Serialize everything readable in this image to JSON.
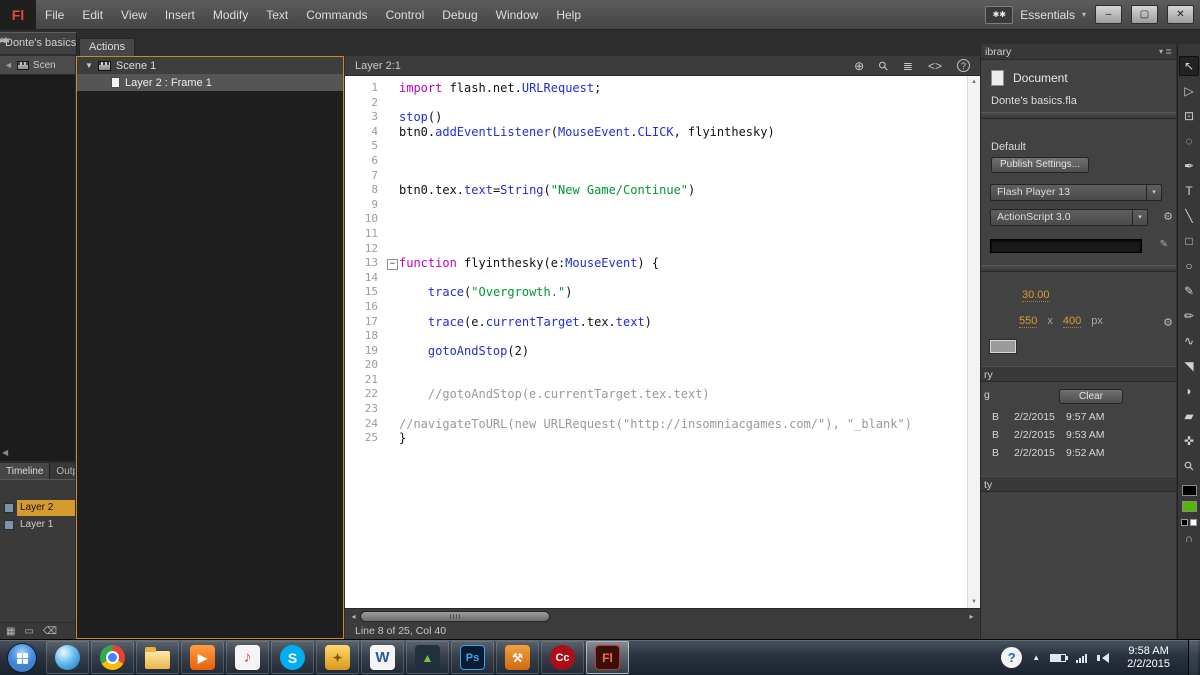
{
  "menu": {
    "logo": "Fl",
    "items": [
      "File",
      "Edit",
      "View",
      "Insert",
      "Modify",
      "Text",
      "Commands",
      "Control",
      "Debug",
      "Window",
      "Help"
    ],
    "workspace": "Essentials"
  },
  "window": {
    "workspace_badge": "✱✱"
  },
  "icons": {
    "caret": "▾",
    "min": "–",
    "max": "▢",
    "close": "✕",
    "collapse_pair": "◂◂",
    "expand_pair": "▸▸",
    "panel_menu": "▾ ≣",
    "back": "◄",
    "left_nudge": "◀",
    "tree_disclosure": "▼",
    "scroll_left": "◂",
    "scroll_right": "▸",
    "scroll_up": "▲",
    "scroll_down": "▼",
    "wrench": "⚙",
    "pencil": "✎",
    "tray_up": "▲"
  },
  "doc_tab": "Donte's basics",
  "edit_bar": {
    "scene": "Scen"
  },
  "actions": {
    "tab": "Actions",
    "scene": "Scene 1",
    "frame": "Layer 2 : Frame 1"
  },
  "editor": {
    "title": "Layer 2:1",
    "status": "Line 8 of 25, Col 40",
    "toolbar": [
      {
        "name": "insert-target-path",
        "glyph": "⊕"
      },
      {
        "name": "find",
        "glyph": "⚲"
      },
      {
        "name": "format-code",
        "glyph": "≣"
      },
      {
        "name": "code-snippets",
        "glyph": "<>"
      },
      {
        "name": "help",
        "glyph": "?"
      }
    ],
    "lines": [
      {
        "n": 1,
        "t": [
          [
            "k",
            "import"
          ],
          [
            "p",
            " flash.net."
          ],
          [
            "i",
            "URLRequest"
          ],
          [
            "p",
            ";"
          ]
        ]
      },
      {
        "n": 2,
        "t": []
      },
      {
        "n": 3,
        "t": [
          [
            "i",
            "stop"
          ],
          [
            "p",
            "()"
          ]
        ]
      },
      {
        "n": 4,
        "t": [
          [
            "p",
            "btn0."
          ],
          [
            "i",
            "addEventListener"
          ],
          [
            "p",
            "("
          ],
          [
            "i",
            "MouseEvent"
          ],
          [
            "p",
            "."
          ],
          [
            "i",
            "CLICK"
          ],
          [
            "p",
            ", flyinthesky)"
          ]
        ]
      },
      {
        "n": 5,
        "t": []
      },
      {
        "n": 6,
        "t": []
      },
      {
        "n": 7,
        "t": []
      },
      {
        "n": 8,
        "t": [
          [
            "p",
            "btn0.tex."
          ],
          [
            "i",
            "text"
          ],
          [
            "p",
            "="
          ],
          [
            "i",
            "String"
          ],
          [
            "p",
            "("
          ],
          [
            "s",
            "\"New Game/Continue\""
          ],
          [
            "p",
            ")"
          ]
        ]
      },
      {
        "n": 9,
        "t": []
      },
      {
        "n": 10,
        "t": []
      },
      {
        "n": 11,
        "t": []
      },
      {
        "n": 12,
        "t": []
      },
      {
        "n": 13,
        "fold": true,
        "t": [
          [
            "k",
            "function"
          ],
          [
            "p",
            " flyinthesky(e:"
          ],
          [
            "i",
            "MouseEvent"
          ],
          [
            "p",
            ") {"
          ]
        ]
      },
      {
        "n": 14,
        "t": []
      },
      {
        "n": 15,
        "t": [
          [
            "p",
            "    "
          ],
          [
            "i",
            "trace"
          ],
          [
            "p",
            "("
          ],
          [
            "s",
            "\"Overgrowth.\""
          ],
          [
            "p",
            ")"
          ]
        ]
      },
      {
        "n": 16,
        "t": []
      },
      {
        "n": 17,
        "t": [
          [
            "p",
            "    "
          ],
          [
            "i",
            "trace"
          ],
          [
            "p",
            "(e."
          ],
          [
            "i",
            "currentTarget"
          ],
          [
            "p",
            ".tex."
          ],
          [
            "i",
            "text"
          ],
          [
            "p",
            ")"
          ]
        ]
      },
      {
        "n": 18,
        "t": []
      },
      {
        "n": 19,
        "t": [
          [
            "p",
            "    "
          ],
          [
            "i",
            "gotoAndStop"
          ],
          [
            "p",
            "(2)"
          ]
        ]
      },
      {
        "n": 20,
        "t": []
      },
      {
        "n": 21,
        "t": []
      },
      {
        "n": 22,
        "t": [
          [
            "c",
            "    //gotoAndStop(e.currentTarget.tex.text)"
          ]
        ]
      },
      {
        "n": 23,
        "t": []
      },
      {
        "n": 24,
        "t": [
          [
            "c",
            "//navigateToURL(new URLRequest(\"http://insomniacgames.com/\"), \"_blank\")"
          ]
        ]
      },
      {
        "n": 25,
        "t": [
          [
            "p",
            "}"
          ]
        ]
      }
    ]
  },
  "inspector": {
    "tab_fragment": "ibrary",
    "document_label": "Document",
    "file_name": "Donte's basics.fla",
    "profile": "Default",
    "publish_button": "Publish Settings...",
    "target_select": "Flash Player 13",
    "script_select": "ActionScript 3.0",
    "fps": "30.00",
    "width": "550",
    "times": "x",
    "height": "400",
    "unit": "px"
  },
  "history": {
    "tab_fragment": "ry",
    "left_fragment": "g",
    "clear_button": "Clear",
    "rows": [
      {
        "col": "B",
        "date": "2/2/2015",
        "time": "9:57 AM"
      },
      {
        "col": "B",
        "date": "2/2/2015",
        "time": "9:53 AM"
      },
      {
        "col": "B",
        "date": "2/2/2015",
        "time": "9:52 AM"
      }
    ],
    "bottom_tab_fragment": "ty"
  },
  "timeline": {
    "tabs": [
      "Timeline",
      "Outp"
    ],
    "layers": [
      {
        "name": "Layer 2",
        "selected": true
      },
      {
        "name": "Layer 1",
        "selected": false
      }
    ],
    "buttons": [
      {
        "name": "new-layer",
        "glyph": "▦"
      },
      {
        "name": "new-folder",
        "glyph": "▭"
      },
      {
        "name": "delete-layer",
        "glyph": "⌫"
      }
    ]
  },
  "tools": [
    {
      "name": "selection-tool",
      "glyph": "↖",
      "selected": true
    },
    {
      "name": "subselection-tool",
      "glyph": "▷"
    },
    {
      "name": "free-transform-tool",
      "glyph": "⊡"
    },
    {
      "name": "lasso-tool",
      "glyph": "◌"
    },
    {
      "name": "pen-tool",
      "glyph": "✒"
    },
    {
      "name": "text-tool",
      "glyph": "T"
    },
    {
      "name": "line-tool",
      "glyph": "╲"
    },
    {
      "name": "rectangle-tool",
      "glyph": "□"
    },
    {
      "name": "oval-tool",
      "glyph": "○"
    },
    {
      "name": "pencil-tool",
      "glyph": "✎"
    },
    {
      "name": "brush-tool",
      "glyph": "✏"
    },
    {
      "name": "deco-tool",
      "glyph": "∿"
    },
    {
      "name": "paint-bucket-tool",
      "glyph": "◥"
    },
    {
      "name": "eyedropper-tool",
      "glyph": "◗"
    },
    {
      "name": "eraser-tool",
      "glyph": "▰"
    },
    {
      "name": "hand-tool",
      "glyph": "✜"
    },
    {
      "name": "zoom-tool",
      "glyph": "⚲"
    }
  ],
  "taskbar": {
    "clock_time": "9:58 AM",
    "clock_date": "2/2/2015",
    "apps": [
      {
        "name": "internet-browser",
        "kind": "globe",
        "glyph": ""
      },
      {
        "name": "chrome",
        "kind": "chrome",
        "glyph": ""
      },
      {
        "name": "file-explorer",
        "kind": "folder",
        "glyph": ""
      },
      {
        "name": "media-player",
        "kind": "play",
        "glyph": "▶"
      },
      {
        "name": "itunes",
        "kind": "note",
        "glyph": "♪"
      },
      {
        "name": "skype",
        "kind": "skype",
        "glyph": "S"
      },
      {
        "name": "notes-app",
        "kind": "gold",
        "glyph": "✦"
      },
      {
        "name": "word",
        "kind": "word",
        "glyph": "W"
      },
      {
        "name": "photo-viewer",
        "kind": "photo",
        "glyph": "▲"
      },
      {
        "name": "photoshop",
        "kind": "ps",
        "glyph": "Ps"
      },
      {
        "name": "utility-app",
        "kind": "tools",
        "glyph": "⚒"
      },
      {
        "name": "creative-cloud",
        "kind": "cc",
        "glyph": "Cc"
      },
      {
        "name": "flash-professional",
        "kind": "flash",
        "glyph": "Fl",
        "active": true
      }
    ]
  }
}
